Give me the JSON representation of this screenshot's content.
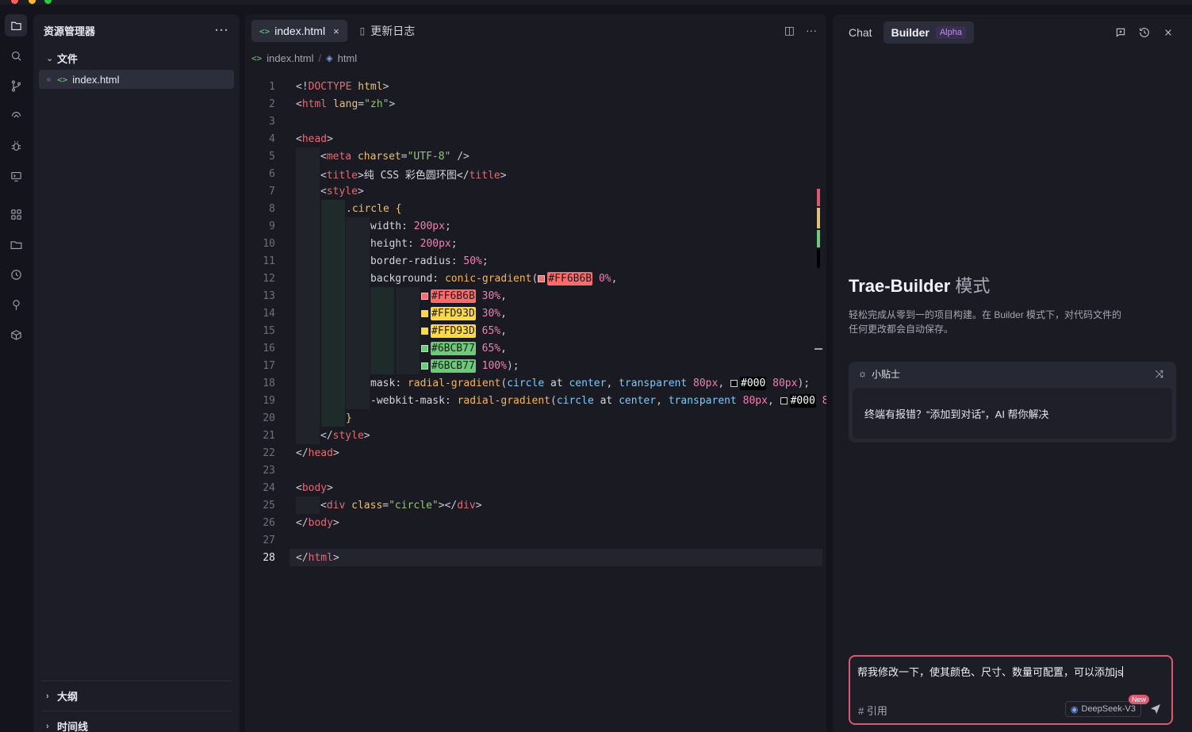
{
  "explorer": {
    "title": "资源管理器",
    "more": "···",
    "folder": "文件",
    "file": "index.html",
    "file_icon": "<>",
    "outline": "大纲",
    "timeline": "时间线"
  },
  "editor": {
    "tabs": [
      {
        "label": "index.html",
        "icon": "<>",
        "close": "×"
      },
      {
        "label": "更新日志"
      }
    ],
    "actions": {
      "split": "◫",
      "more": "···"
    },
    "breadcrumb": [
      "index.html",
      "html"
    ],
    "lines": [
      "1",
      "2",
      "3",
      "4",
      "5",
      "6",
      "7",
      "8",
      "9",
      "10",
      "11",
      "12",
      "13",
      "14",
      "15",
      "16",
      "17",
      "18",
      "19",
      "20",
      "21",
      "22",
      "23",
      "24",
      "25",
      "26",
      "27",
      "28"
    ],
    "code": {
      "l1": [
        "<!",
        "DOCTYPE",
        " html",
        ">"
      ],
      "l2": [
        "<",
        "html",
        " lang",
        "=",
        "\"zh\"",
        ">"
      ],
      "l4": [
        "<",
        "head",
        ">"
      ],
      "l5": [
        "<",
        "meta",
        " charset",
        "=",
        "\"UTF-8\"",
        " />"
      ],
      "l6": [
        "<",
        "title",
        ">纯 CSS 彩色圆环图</",
        "title",
        ">"
      ],
      "l7": [
        "<",
        "style",
        ">"
      ],
      "l8": [
        ".circle",
        " {"
      ],
      "l9": [
        "width",
        ": ",
        "200px",
        ";"
      ],
      "l10": [
        "height",
        ": ",
        "200px",
        ";"
      ],
      "l11": [
        "border-radius",
        ": ",
        "50%",
        ";"
      ],
      "l12": [
        "background",
        ": ",
        "conic-gradient",
        "(",
        "#FF6B6B",
        " 0%",
        ","
      ],
      "l13": [
        "#FF6B6B",
        " 30%",
        ","
      ],
      "l14": [
        "#FFD93D",
        " 30%",
        ","
      ],
      "l15": [
        "#FFD93D",
        " 65%",
        ","
      ],
      "l16": [
        "#6BCB77",
        " 65%",
        ","
      ],
      "l17": [
        "#6BCB77",
        " 100%",
        ");"
      ],
      "l18": [
        "mask",
        ": ",
        "radial-gradient",
        "(",
        "circle",
        " at ",
        "center",
        ", ",
        "transparent",
        " 80px",
        ", ",
        "#000",
        " 80px",
        ");"
      ],
      "l19": [
        "-webkit-mask",
        ": ",
        "radial-gradient",
        "(",
        "circle",
        " at ",
        "center",
        ", ",
        "transparent",
        " 80px",
        ", ",
        "#000",
        " 8"
      ],
      "l20": [
        "}"
      ],
      "l21": [
        "</",
        "style",
        ">"
      ],
      "l22": [
        "</",
        "head",
        ">"
      ],
      "l24": [
        "<",
        "body",
        ">"
      ],
      "l25": [
        "<",
        "div",
        " class",
        "=",
        "\"circle\"",
        "></",
        "div",
        ">"
      ],
      "l26": [
        "</",
        "body",
        ">"
      ],
      "l28": [
        "</",
        "html",
        ">"
      ]
    }
  },
  "panel": {
    "tabs": {
      "chat": "Chat",
      "builder": "Builder",
      "badge": "Alpha"
    },
    "title": "Trae-Builder",
    "title_mode": "模式",
    "description": "轻松完成从零到一的项目构建。在 Builder 模式下，对代码文件的任何更改都会自动保存。",
    "tips_title": "小贴士",
    "tips_body": "终端有报错？“添加到对话”，AI 帮你解决",
    "input_value": "帮我修改一下，使其颜色、尺寸、数量可配置，可以添加js",
    "ref_label": "# 引用",
    "model": "DeepSeek-V3",
    "new_badge": "New"
  },
  "colors": {
    "red": "#FF6B6B",
    "yellow": "#FFD93D",
    "green": "#6BCB77",
    "accent_border": "#e0566f"
  }
}
